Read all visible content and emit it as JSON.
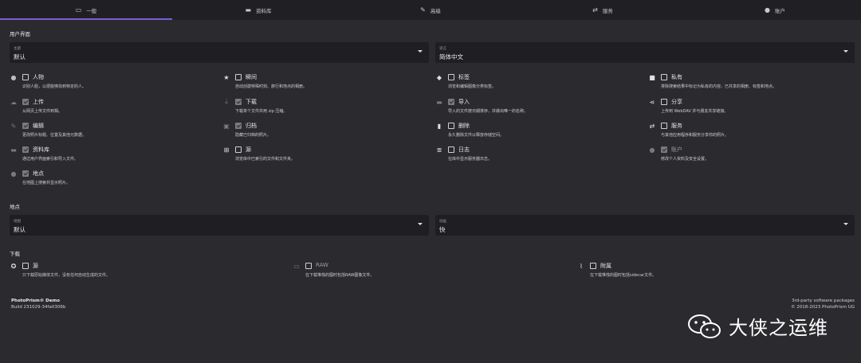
{
  "tabs": [
    {
      "label": "一般",
      "icon": "monitor-icon",
      "glyph": "▭"
    },
    {
      "label": "资料库",
      "icon": "folder-icon",
      "glyph": "▬"
    },
    {
      "label": "高级",
      "icon": "wrench-icon",
      "glyph": "✎"
    },
    {
      "label": "服务",
      "icon": "swap-arrows-icon",
      "glyph": "⇄"
    },
    {
      "label": "账户",
      "icon": "account-icon",
      "glyph": "●"
    }
  ],
  "ui_section": {
    "title": "用户界面"
  },
  "theme": {
    "label": "主题",
    "value": "默认"
  },
  "language": {
    "label": "语言",
    "value": "简体中文"
  },
  "options": {
    "people": {
      "name": "人物",
      "desc": "识别人脸，以便能够找到特定的人。",
      "icon": "person-icon",
      "glyph": "●"
    },
    "moments": {
      "name": "瞬间",
      "desc": "自动创建特殊时刻、旅行和地点的相册。",
      "icon": "star-icon",
      "glyph": "★"
    },
    "labels": {
      "name": "标签",
      "desc": "浏览和编辑图像分类标签。",
      "icon": "label-icon",
      "glyph": "◆"
    },
    "private": {
      "name": "私有",
      "desc": "排除搜索结果中标记为私有的内容。已共享的相册、标签和地点。",
      "icon": "lock-icon",
      "glyph": "■"
    },
    "upload": {
      "name": "上传",
      "desc": "从网页上传文件到相。",
      "icon": "cloud-upload-icon",
      "glyph": "☁"
    },
    "download": {
      "name": "下载",
      "desc": "下载单个文件并用 zip 压缩。",
      "icon": "download-icon",
      "glyph": "⤓"
    },
    "import": {
      "name": "导入",
      "desc": "导入的文件按日期排序，并做出唯一的名称。",
      "icon": "folder-import-icon",
      "glyph": "▬"
    },
    "share": {
      "name": "分享",
      "desc": "上传到 WebDAV 并与朋友共享链接。",
      "icon": "share-icon",
      "glyph": "⋖"
    },
    "edit": {
      "name": "编辑",
      "desc": "更改照片标题、位置及其他元数据。",
      "icon": "pencil-icon",
      "glyph": "✎"
    },
    "archive": {
      "name": "归档",
      "desc": "隐藏已归档的照片。",
      "icon": "archive-icon",
      "glyph": "▣"
    },
    "delete": {
      "name": "删除",
      "desc": "永久删除文件以释放存储空间。",
      "icon": "trash-icon",
      "glyph": "▮"
    },
    "services": {
      "name": "服务",
      "desc": "与其他应用程序和服务分享你的照片。",
      "icon": "swap-arrows-icon",
      "glyph": "⇄"
    },
    "library": {
      "name": "资料库",
      "desc": "通过用户界面索引和导入文件。",
      "icon": "folder-icon",
      "glyph": "▬"
    },
    "originals": {
      "name": "源",
      "desc": "浏览库中已索引的文件和文件夹。",
      "icon": "file-tree-icon",
      "glyph": "⊞"
    },
    "logs": {
      "name": "日志",
      "desc": "在库中显示服务器日志。",
      "icon": "log-icon",
      "glyph": "≣"
    },
    "account": {
      "name": "账户",
      "desc": "修改个人资料及安全设置。",
      "icon": "account-icon",
      "glyph": "●"
    },
    "places": {
      "name": "地点",
      "desc": "在地图上搜索并显示照片。",
      "icon": "map-marker-icon",
      "glyph": "●"
    }
  },
  "places_section": {
    "title": "地点"
  },
  "map": {
    "label": "地图",
    "value": "默认"
  },
  "animation": {
    "label": "动画",
    "value": "快"
  },
  "download_section": {
    "title": "下载"
  },
  "download_options": {
    "originals": {
      "name": "源",
      "desc": "只下载原始媒体文件，没有任何自动生成的文件。",
      "icon": "originals-icon",
      "glyph": "✪"
    },
    "raw": {
      "name": "RAW",
      "desc": "在下载堆栈的图时包括RAW图像文件。",
      "icon": "raw-icon",
      "glyph": "▭"
    },
    "sidecar": {
      "name": "附属",
      "desc": "在下载堆栈的图时包括sidecar文件。",
      "icon": "paperclip-icon",
      "glyph": "⌇"
    }
  },
  "footer": {
    "app": "PhotoPrism® Demo",
    "build": "Build 231029-34fa0306b",
    "third_party": "3rd-party software packages",
    "copyright": "© 2018-2023 PhotoPrism UG"
  },
  "watermark": {
    "text": "大侠之运维",
    "icon": "wechat-icon"
  }
}
